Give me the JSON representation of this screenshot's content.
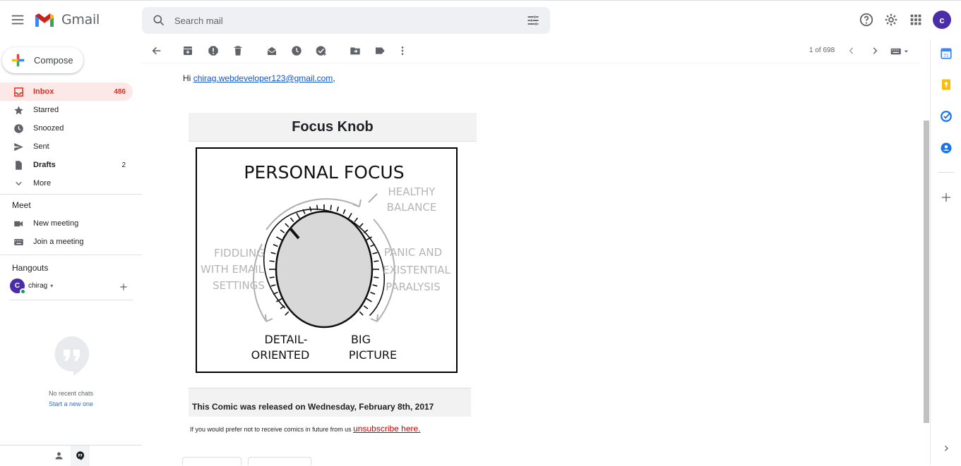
{
  "app": {
    "name": "Gmail"
  },
  "search": {
    "placeholder": "Search mail"
  },
  "user": {
    "initial": "c"
  },
  "compose": {
    "label": "Compose"
  },
  "nav": [
    {
      "label": "Inbox",
      "count": "486",
      "icon": "inbox-icon",
      "active": true
    },
    {
      "label": "Starred",
      "count": "",
      "icon": "star-icon"
    },
    {
      "label": "Snoozed",
      "count": "",
      "icon": "clock-icon"
    },
    {
      "label": "Sent",
      "count": "",
      "icon": "send-icon"
    },
    {
      "label": "Drafts",
      "count": "2",
      "icon": "draft-icon",
      "bold": true
    },
    {
      "label": "More",
      "count": "",
      "icon": "chevron-down-icon"
    }
  ],
  "meet": {
    "title": "Meet",
    "items": [
      {
        "label": "New meeting",
        "icon": "video-icon"
      },
      {
        "label": "Join a meeting",
        "icon": "keyboard-icon"
      }
    ]
  },
  "hangouts": {
    "title": "Hangouts",
    "user_initial": "C",
    "user_name": "chirag",
    "empty_text": "No recent chats",
    "start_link": "Start a new one"
  },
  "toolbar": {
    "pager": "1 of 698"
  },
  "email": {
    "greeting_prefix": "Hi",
    "email_address": "chirag.webdeveloper123@gmail.com",
    "greeting_suffix": ",",
    "comic_title": "Focus Knob",
    "comic": {
      "heading": "PERSONAL FOCUS",
      "top_right": [
        "HEALTHY",
        "BALANCE"
      ],
      "left": [
        "FIDDLING",
        "WITH EMAIL",
        "SETTINGS"
      ],
      "right": [
        "PANIC AND",
        "EXISTENTIAL",
        "PARALYSIS"
      ],
      "bottom_left": [
        "DETAIL-",
        "ORIENTED"
      ],
      "bottom_right": [
        "BIG",
        "PICTURE"
      ]
    },
    "release_text": "This Comic was released on Wednesday, February 8th, 2017",
    "unsub_prefix": "If you would prefer not to receive comics in future from us",
    "unsub_link": "unsubscribe here."
  },
  "colors": {
    "accent": "#d93025",
    "link": "#1155cc",
    "avatar": "#4a2ea8"
  }
}
